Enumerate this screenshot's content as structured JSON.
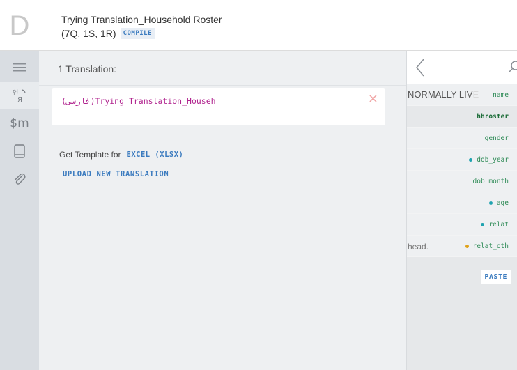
{
  "header": {
    "logo": "D",
    "title": "Trying Translation_Household Roster",
    "counts": "(7Q, 1S, 1R)",
    "compile_label": "COMPILE"
  },
  "sidebar": {
    "items": [
      {
        "icon": "menu-icon"
      },
      {
        "icon": "translation-icon",
        "active": true
      },
      {
        "icon": "macros-icon",
        "text": "$m"
      },
      {
        "icon": "lookup-table-icon"
      },
      {
        "icon": "attachment-icon"
      }
    ]
  },
  "translations": {
    "heading": "1 Translation:",
    "items": [
      {
        "label": "(فارسی)Trying Translation_Househ"
      }
    ],
    "template_label": "Get Template for",
    "excel_label": "EXCEL (XLSX)",
    "upload_label": "UPLOAD NEW TRANSLATION"
  },
  "variables": {
    "rows": [
      {
        "name": "name",
        "prefix": "NORMALLY LIV",
        "prefix_faded": "E",
        "dot": null
      },
      {
        "name": "hhroster",
        "bold": true,
        "dot": null
      },
      {
        "name": "gender",
        "dot": null
      },
      {
        "name": "dob_year",
        "dot": "#1fa3b0"
      },
      {
        "name": "dob_month",
        "dot": null
      },
      {
        "name": "age",
        "dot": "#1fa3b0"
      },
      {
        "name": "relat",
        "dot": "#1fa3b0"
      },
      {
        "name": "relat_oth",
        "prefix": "head.",
        "dot": "#e0a21b"
      }
    ],
    "paste_label": "PASTE"
  },
  "colors": {
    "accent": "#3b7bbf",
    "translation_text": "#b0238e",
    "variable_text": "#2e8b57"
  }
}
